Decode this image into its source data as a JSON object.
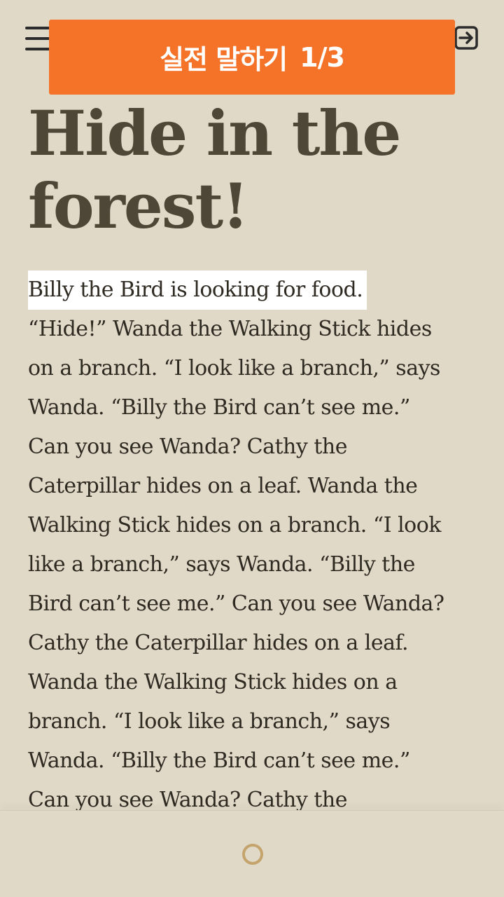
{
  "banner": {
    "label": "실전 말하기",
    "progress": "1/3"
  },
  "story": {
    "title_lines": [
      "Hide in the",
      "forest!"
    ],
    "highlighted_line": "Billy the Bird is looking for   food.",
    "lines": [
      "“Hide!” Wanda the Walking Stick hides",
      "on a branch. “I look like a branch,” says",
      "Wanda. “Billy the Bird can’t see me.”",
      "Can you see Wanda? Cathy the",
      "Caterpillar hides on a leaf. Wanda the",
      "Walking Stick hides on a branch. “I look",
      "like a branch,” says Wanda. “Billy the",
      "Bird can’t see me.” Can you see Wanda?",
      "Cathy the Caterpillar hides on a leaf.",
      "Wanda the Walking Stick hides on a",
      "branch. “I look like a branch,” says",
      "Wanda. “Billy the Bird can’t see me.”",
      "Can you see Wanda? Cathy the"
    ]
  },
  "icons": {
    "menu": "hamburger-menu-icon",
    "exit": "exit-arrow-icon",
    "record": "record-ring-icon"
  },
  "colors": {
    "background": "#e0d9c7",
    "banner": "#f47328",
    "title": "#4e4738",
    "text": "#2e2a22",
    "highlight": "#ffffff",
    "record_ring": "#c4a46c"
  }
}
